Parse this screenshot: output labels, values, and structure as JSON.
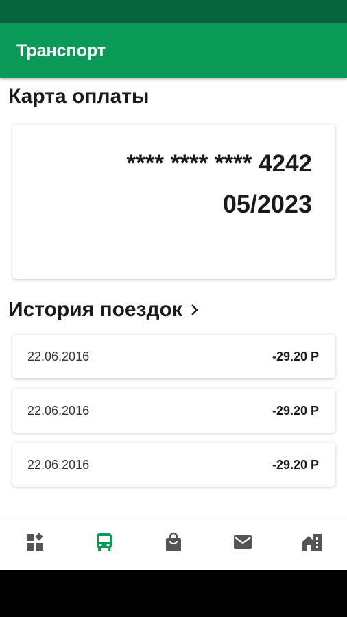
{
  "app": {
    "title": "Транспорт"
  },
  "payment_card": {
    "section_title": "Карта оплаты",
    "masked_number": "**** **** **** 4242",
    "expiry": "05/2023"
  },
  "trip_history": {
    "section_title": "История поездок",
    "trips": [
      {
        "date": "22.06.2016",
        "amount": "-29.20 Р"
      },
      {
        "date": "22.06.2016",
        "amount": "-29.20 Р"
      },
      {
        "date": "22.06.2016",
        "amount": "-29.20 Р"
      }
    ]
  },
  "bottom_nav": {
    "items": [
      {
        "icon": "dashboard-icon",
        "active": false
      },
      {
        "icon": "bus-icon",
        "active": true
      },
      {
        "icon": "shopping-bag-icon",
        "active": false
      },
      {
        "icon": "mail-icon",
        "active": false
      },
      {
        "icon": "home-city-icon",
        "active": false
      }
    ]
  },
  "colors": {
    "status_bar": "#06653c",
    "app_bar": "#0a9a57",
    "nav_active": "#0a9a57",
    "nav_inactive": "#555555"
  }
}
